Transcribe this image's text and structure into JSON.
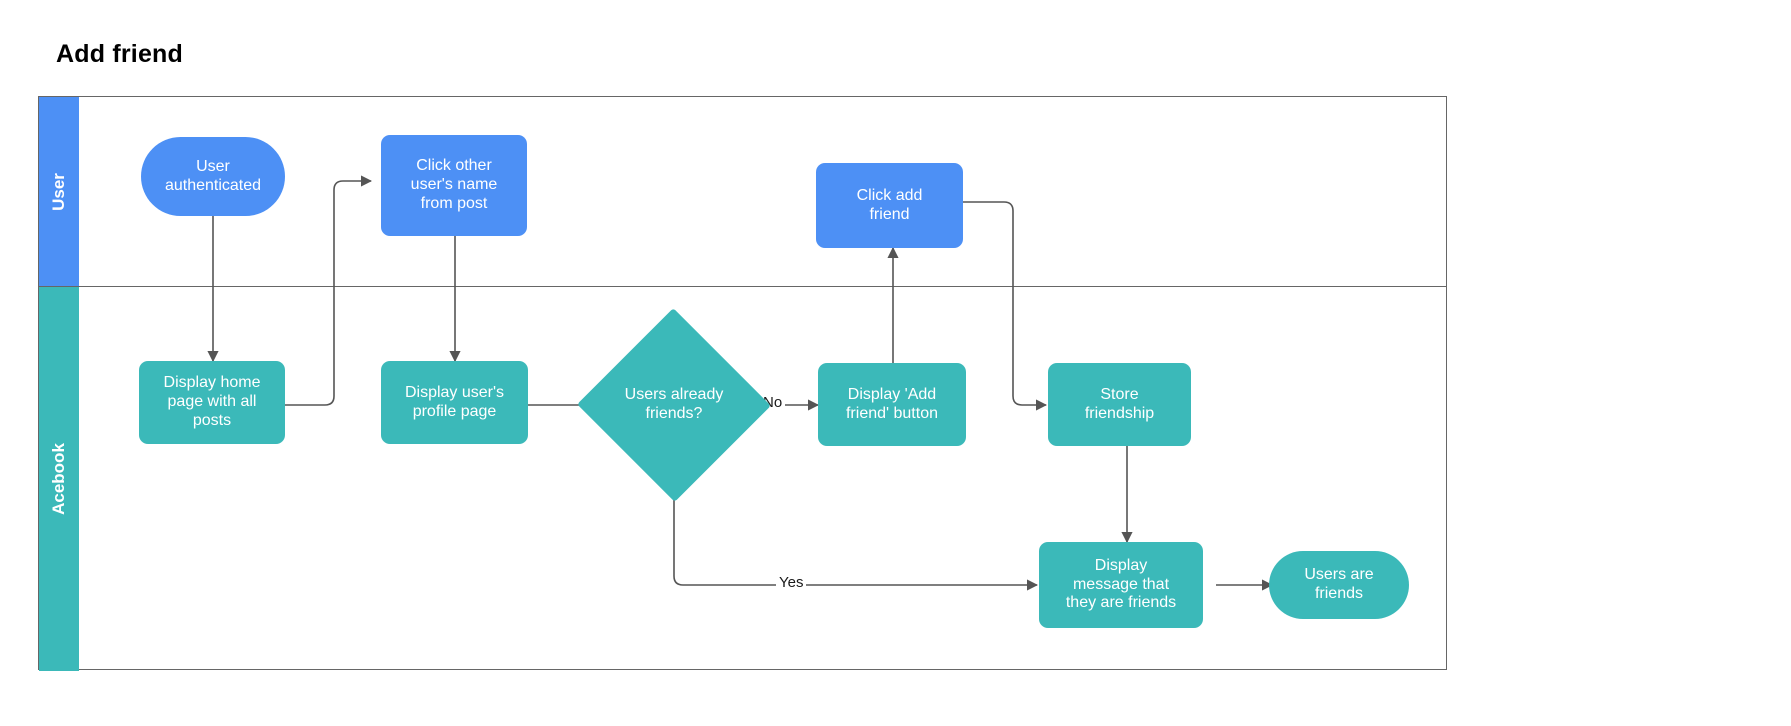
{
  "title": "Add friend",
  "colors": {
    "user_lane": "#4d90f5",
    "acebook_lane": "#3bb9b9",
    "frame_border": "#666666",
    "connector": "#555555",
    "node_text": "#ffffff"
  },
  "lanes": [
    {
      "id": "user",
      "label": "User",
      "color": "#4d90f5"
    },
    {
      "id": "acebook",
      "label": "Acebook",
      "color": "#3bb9b9"
    }
  ],
  "nodes": [
    {
      "id": "user-authenticated",
      "label": "User\nauthenticated",
      "shape": "pill",
      "lane": "user",
      "color": "#4d90f5"
    },
    {
      "id": "click-other-user",
      "label": "Click other\nuser's name\nfrom post",
      "shape": "rect",
      "lane": "user",
      "color": "#4d90f5"
    },
    {
      "id": "click-add-friend",
      "label": "Click add\nfriend",
      "shape": "rect",
      "lane": "user",
      "color": "#4d90f5"
    },
    {
      "id": "display-home-page",
      "label": "Display home\npage with all\nposts",
      "shape": "rect",
      "lane": "acebook",
      "color": "#3bb9b9"
    },
    {
      "id": "display-profile",
      "label": "Display user's\nprofile page",
      "shape": "rect",
      "lane": "acebook",
      "color": "#3bb9b9"
    },
    {
      "id": "users-already-friends",
      "label": "Users already\nfriends?",
      "shape": "diamond",
      "lane": "acebook",
      "color": "#3bb9b9"
    },
    {
      "id": "display-add-button",
      "label": "Display 'Add\nfriend' button",
      "shape": "rect",
      "lane": "acebook",
      "color": "#3bb9b9"
    },
    {
      "id": "store-friendship",
      "label": "Store\nfriendship",
      "shape": "rect",
      "lane": "acebook",
      "color": "#3bb9b9"
    },
    {
      "id": "display-message",
      "label": "Display\nmessage that\nthey are friends",
      "shape": "rect",
      "lane": "acebook",
      "color": "#3bb9b9"
    },
    {
      "id": "users-are-friends",
      "label": "Users are\nfriends",
      "shape": "pill",
      "lane": "acebook",
      "color": "#3bb9b9"
    }
  ],
  "edge_labels": {
    "no": "No",
    "yes": "Yes"
  },
  "edges": [
    {
      "from": "user-authenticated",
      "to": "display-home-page",
      "label": ""
    },
    {
      "from": "display-home-page",
      "to": "click-other-user",
      "label": ""
    },
    {
      "from": "click-other-user",
      "to": "display-profile",
      "label": ""
    },
    {
      "from": "display-profile",
      "to": "users-already-friends",
      "label": ""
    },
    {
      "from": "users-already-friends",
      "to": "display-add-button",
      "label": "No"
    },
    {
      "from": "users-already-friends",
      "to": "display-message",
      "label": "Yes"
    },
    {
      "from": "display-add-button",
      "to": "click-add-friend",
      "label": ""
    },
    {
      "from": "click-add-friend",
      "to": "store-friendship",
      "label": ""
    },
    {
      "from": "store-friendship",
      "to": "display-message",
      "label": ""
    },
    {
      "from": "display-message",
      "to": "users-are-friends",
      "label": ""
    }
  ]
}
